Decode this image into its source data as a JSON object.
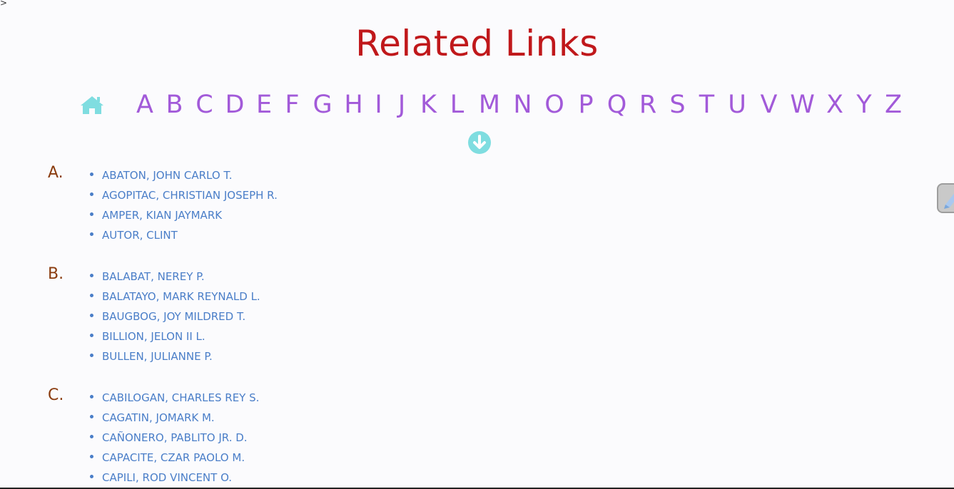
{
  "page": {
    "title": "Related Links",
    "corner_mark": ">"
  },
  "nav": {
    "home_icon": "home-icon",
    "letters": [
      "A",
      "B",
      "C",
      "D",
      "E",
      "F",
      "G",
      "H",
      "I",
      "J",
      "K",
      "L",
      "M",
      "N",
      "O",
      "P",
      "Q",
      "R",
      "S",
      "T",
      "U",
      "V",
      "W",
      "X",
      "Y",
      "Z"
    ],
    "down_icon": "arrow-circle-down-icon"
  },
  "colors": {
    "title": "#c0181b",
    "letters": "#a25ad9",
    "icons": "#7fdde0",
    "section_letter": "#8a3c0f",
    "links": "#4a7ec8"
  },
  "sections": [
    {
      "label": "A.",
      "items": [
        "ABATON, JOHN CARLO T.",
        "AGOPITAC, CHRISTIAN JOSEPH R.",
        "AMPER, KIAN JAYMARK",
        "AUTOR, CLINT"
      ]
    },
    {
      "label": "B.",
      "items": [
        "BALABAT, NEREY P.",
        "BALATAYO, MARK REYNALD L.",
        "BAUGBOG, JOY MILDRED T.",
        "BILLION, JELON II L.",
        "BULLEN, JULIANNE P."
      ]
    },
    {
      "label": "C.",
      "items": [
        "CABILOGAN, CHARLES REY S.",
        "CAGATIN, JOMARK M.",
        "CAÑONERO, PABLITO JR. D.",
        "CAPACITE, CZAR PAOLO M.",
        "CAPILI, ROD VINCENT O."
      ]
    }
  ],
  "side_tab": {
    "icon": "edit-pencil-icon"
  }
}
